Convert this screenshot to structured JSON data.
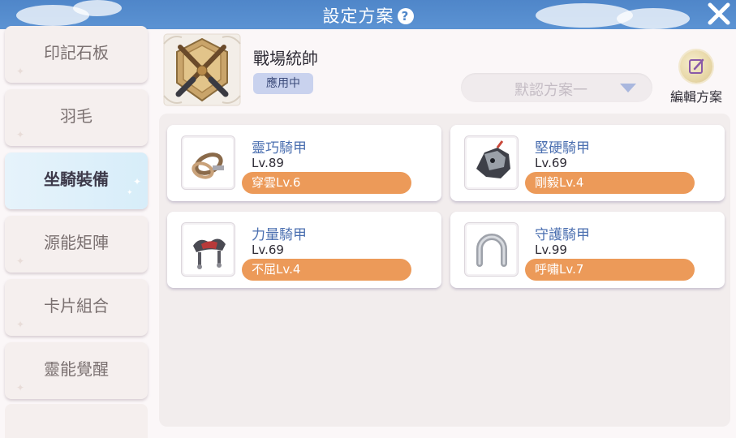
{
  "header": {
    "title": "設定方案",
    "help_icon": "question-mark-icon",
    "close_icon": "close-icon"
  },
  "sidebar": {
    "items": [
      {
        "label": "印記石板",
        "active": false
      },
      {
        "label": "羽毛",
        "active": false
      },
      {
        "label": "坐騎裝備",
        "active": true
      },
      {
        "label": "源能矩陣",
        "active": false
      },
      {
        "label": "卡片組合",
        "active": false
      },
      {
        "label": "靈能覺醒",
        "active": false
      }
    ]
  },
  "plan": {
    "emblem_icon": "crossed-guns-emblem-icon",
    "name": "戰場統帥",
    "status": "應用中",
    "select_value": "默認方案一",
    "edit_label": "編輯方案",
    "edit_icon": "edit-icon"
  },
  "equipment": [
    {
      "name": "靈巧騎甲",
      "level": "Lv.89",
      "enchant": "穿雲Lv.6",
      "icon": "reins-icon"
    },
    {
      "name": "堅硬騎甲",
      "level": "Lv.69",
      "enchant": "剛毅Lv.4",
      "icon": "horse-armor-icon"
    },
    {
      "name": "力量騎甲",
      "level": "Lv.69",
      "enchant": "不屈Lv.4",
      "icon": "saddle-icon"
    },
    {
      "name": "守護騎甲",
      "level": "Lv.99",
      "enchant": "呼嘯Lv.7",
      "icon": "horseshoe-icon"
    }
  ],
  "colors": {
    "header_blue": "#5c93d3",
    "accent_orange": "#ec9a59",
    "name_blue": "#4b6fb0",
    "badge_bg": "#c9d2ee"
  }
}
